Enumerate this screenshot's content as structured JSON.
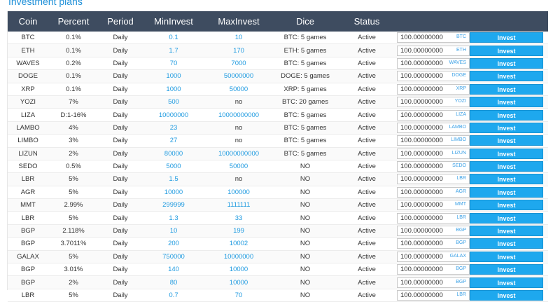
{
  "page": {
    "title": "Investment plans"
  },
  "table": {
    "headers": [
      "Coin",
      "Percent",
      "Period",
      "MinInvest",
      "MaxInvest",
      "Dice",
      "Status"
    ],
    "invest_label": "Invest",
    "rows": [
      {
        "coin": "BTC",
        "percent": "0.1%",
        "period": "Daily",
        "min": "0.1",
        "max": "10",
        "dice": "BTC: 5 games",
        "status": "Active",
        "amount": "100.00000000",
        "currency": "BTC"
      },
      {
        "coin": "ETH",
        "percent": "0.1%",
        "period": "Daily",
        "min": "1.7",
        "max": "170",
        "dice": "ETH: 5 games",
        "status": "Active",
        "amount": "100.00000000",
        "currency": "ETH"
      },
      {
        "coin": "WAVES",
        "percent": "0.2%",
        "period": "Daily",
        "min": "70",
        "max": "7000",
        "dice": "BTC: 5 games",
        "status": "Active",
        "amount": "100.00000000",
        "currency": "WAVES"
      },
      {
        "coin": "DOGE",
        "percent": "0.1%",
        "period": "Daily",
        "min": "1000",
        "max": "50000000",
        "dice": "DOGE: 5 games",
        "status": "Active",
        "amount": "100.00000000",
        "currency": "DOGE"
      },
      {
        "coin": "XRP",
        "percent": "0.1%",
        "period": "Daily",
        "min": "1000",
        "max": "50000",
        "dice": "XRP: 5 games",
        "status": "Active",
        "amount": "100.00000000",
        "currency": "XRP"
      },
      {
        "coin": "YOZI",
        "percent": "7%",
        "period": "Daily",
        "min": "500",
        "max": "no",
        "dice": "BTC: 20 games",
        "status": "Active",
        "amount": "100.00000000",
        "currency": "YOZI"
      },
      {
        "coin": "LIZA",
        "percent": "D:1-16%",
        "period": "Daily",
        "min": "10000000",
        "max": "10000000000",
        "dice": "BTC: 5 games",
        "status": "Active",
        "amount": "100.00000000",
        "currency": "LIZA"
      },
      {
        "coin": "LAMBO",
        "percent": "4%",
        "period": "Daily",
        "min": "23",
        "max": "no",
        "dice": "BTC: 5 games",
        "status": "Active",
        "amount": "100.00000000",
        "currency": "LAMBO"
      },
      {
        "coin": "LIMBO",
        "percent": "3%",
        "period": "Daily",
        "min": "27",
        "max": "no",
        "dice": "BTC: 5 games",
        "status": "Active",
        "amount": "100.00000000",
        "currency": "LIMBO"
      },
      {
        "coin": "LIZUN",
        "percent": "2%",
        "period": "Daily",
        "min": "80000",
        "max": "10000000000",
        "dice": "BTC: 5 games",
        "status": "Active",
        "amount": "100.00000000",
        "currency": "LIZUN"
      },
      {
        "coin": "SEDO",
        "percent": "0.5%",
        "period": "Daily",
        "min": "5000",
        "max": "50000",
        "dice": "NO",
        "status": "Active",
        "amount": "100.00000000",
        "currency": "SEDO"
      },
      {
        "coin": "LBR",
        "percent": "5%",
        "period": "Daily",
        "min": "1.5",
        "max": "no",
        "dice": "NO",
        "status": "Active",
        "amount": "100.00000000",
        "currency": "LBR"
      },
      {
        "coin": "AGR",
        "percent": "5%",
        "period": "Daily",
        "min": "10000",
        "max": "100000",
        "dice": "NO",
        "status": "Active",
        "amount": "100.00000000",
        "currency": "AGR"
      },
      {
        "coin": "MMT",
        "percent": "2.99%",
        "period": "Daily",
        "min": "299999",
        "max": "1111111",
        "dice": "NO",
        "status": "Active",
        "amount": "100.00000000",
        "currency": "MMT"
      },
      {
        "coin": "LBR",
        "percent": "5%",
        "period": "Daily",
        "min": "1.3",
        "max": "33",
        "dice": "NO",
        "status": "Active",
        "amount": "100.00000000",
        "currency": "LBR"
      },
      {
        "coin": "BGP",
        "percent": "2.118%",
        "period": "Daily",
        "min": "10",
        "max": "199",
        "dice": "NO",
        "status": "Active",
        "amount": "100.00000000",
        "currency": "BGP"
      },
      {
        "coin": "BGP",
        "percent": "3.7011%",
        "period": "Daily",
        "min": "200",
        "max": "10002",
        "dice": "NO",
        "status": "Active",
        "amount": "100.00000000",
        "currency": "BGP"
      },
      {
        "coin": "GALAX",
        "percent": "5%",
        "period": "Daily",
        "min": "750000",
        "max": "10000000",
        "dice": "NO",
        "status": "Active",
        "amount": "100.00000000",
        "currency": "GALAX"
      },
      {
        "coin": "BGP",
        "percent": "3.01%",
        "period": "Daily",
        "min": "140",
        "max": "10000",
        "dice": "NO",
        "status": "Active",
        "amount": "100.00000000",
        "currency": "BGP"
      },
      {
        "coin": "BGP",
        "percent": "2%",
        "period": "Daily",
        "min": "80",
        "max": "10000",
        "dice": "NO",
        "status": "Active",
        "amount": "100.00000000",
        "currency": "BGP"
      },
      {
        "coin": "LBR",
        "percent": "5%",
        "period": "Daily",
        "min": "0.7",
        "max": "70",
        "dice": "NO",
        "status": "Active",
        "amount": "100.00000000",
        "currency": "LBR"
      }
    ]
  }
}
